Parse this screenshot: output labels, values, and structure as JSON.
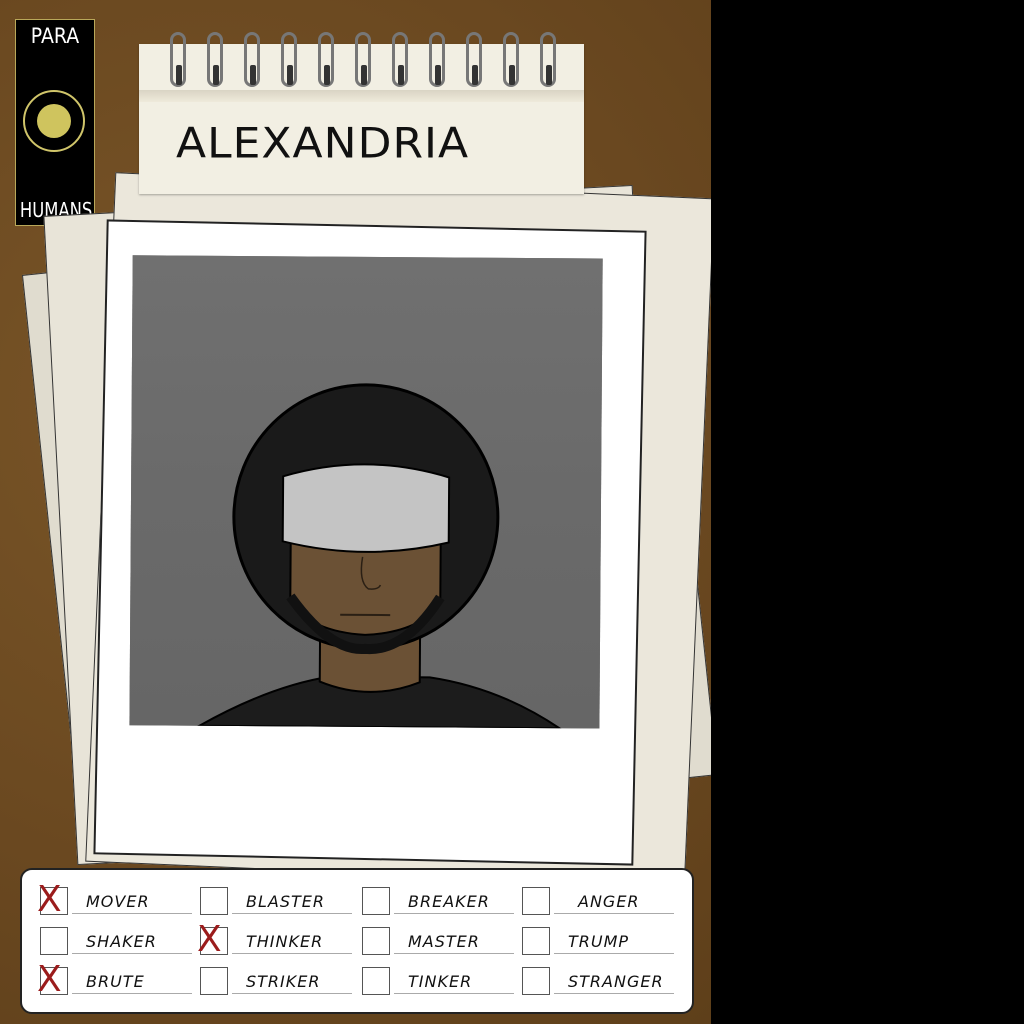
{
  "logo": {
    "top_text": "PARA",
    "bottom_text": "HUMANS"
  },
  "notepad": {
    "name": "ALEXANDRIA"
  },
  "checklist": {
    "rows": [
      [
        {
          "label": "MOVER",
          "checked": true
        },
        {
          "label": "BLASTER",
          "checked": false
        },
        {
          "label": "BREAKER",
          "checked": false
        },
        {
          "label": "ANGER",
          "checked": false
        }
      ],
      [
        {
          "label": "SHAKER",
          "checked": false
        },
        {
          "label": "THINKER",
          "checked": true
        },
        {
          "label": "MASTER",
          "checked": false
        },
        {
          "label": "TRUMP",
          "checked": false
        }
      ],
      [
        {
          "label": "BRUTE",
          "checked": true
        },
        {
          "label": "STRIKER",
          "checked": false
        },
        {
          "label": "TINKER",
          "checked": false
        },
        {
          "label": "STRANGER",
          "checked": false
        }
      ]
    ],
    "check_mark": "X"
  },
  "colors": {
    "board": "#6b4a22",
    "check": "#9b1c1c",
    "logo_accent": "#cfc45e"
  }
}
